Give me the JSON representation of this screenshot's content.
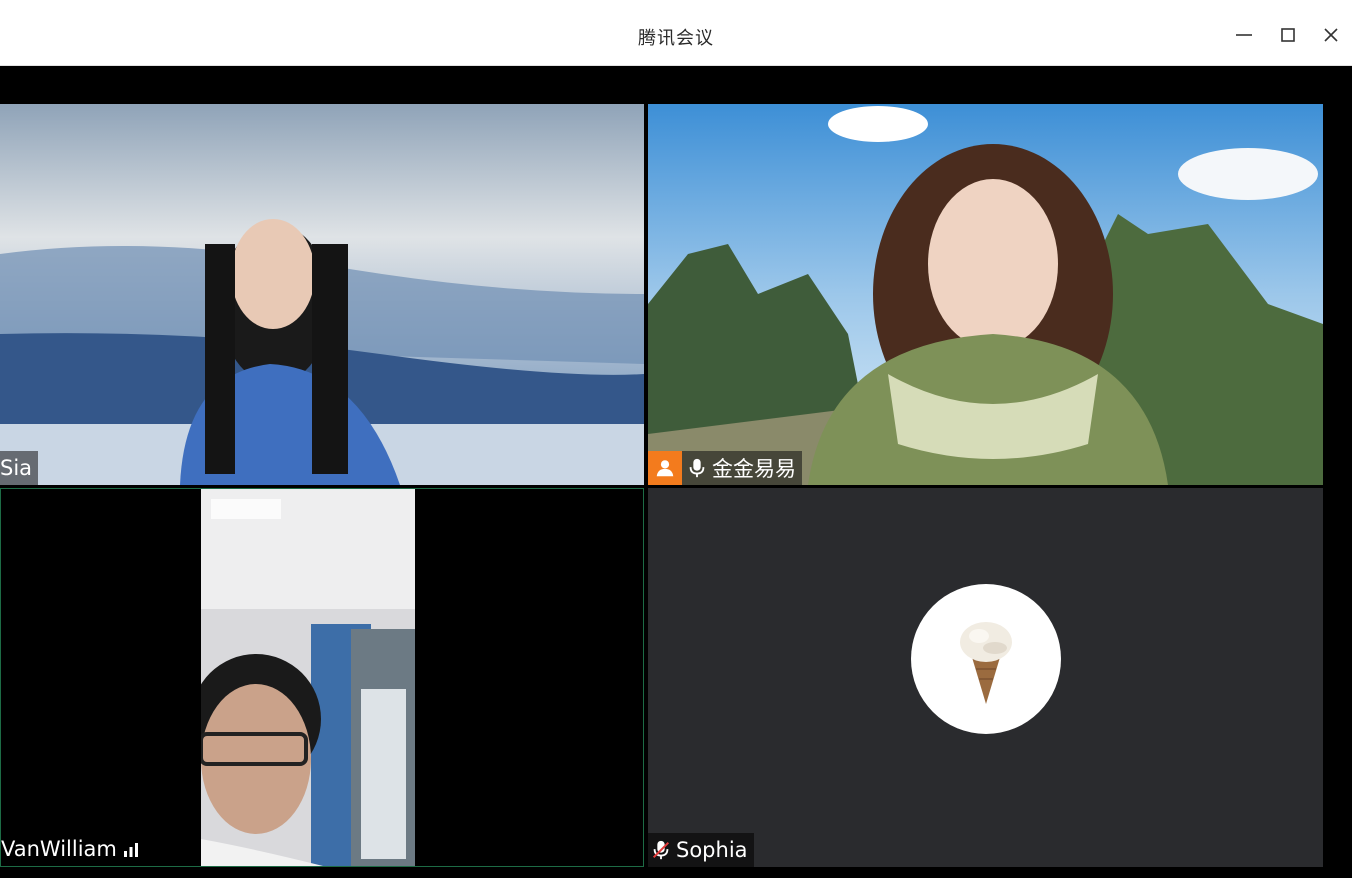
{
  "window": {
    "title": "腾讯会议",
    "controls": [
      "minimize",
      "maximize",
      "close"
    ]
  },
  "participants": [
    {
      "name": "Sia",
      "icons": []
    },
    {
      "name": "金金易易",
      "icons": [
        "host-icon",
        "microphone-icon"
      ]
    },
    {
      "name": "VanWilliam",
      "icons": [
        "signal-strength-icon"
      ]
    },
    {
      "name": "Sophia",
      "icons": [
        "microphone-muted-icon"
      ],
      "avatar": "ice-cream-icon"
    }
  ],
  "colors": {
    "host_badge": "#f37b1d",
    "active_speaker_border": "#1d6b45",
    "empty_tile": "#2a2b2e"
  }
}
